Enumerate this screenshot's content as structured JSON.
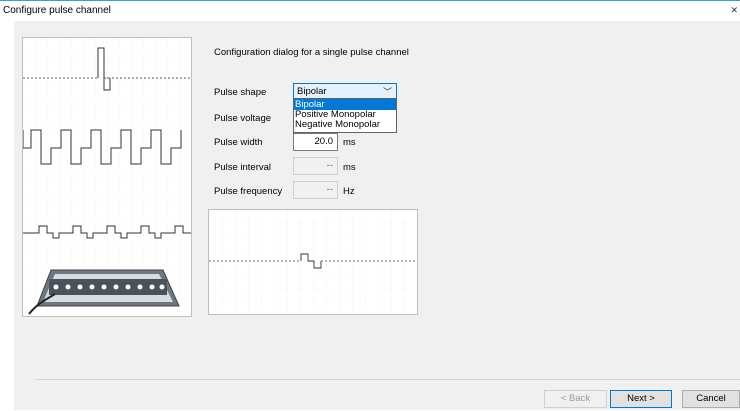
{
  "window": {
    "title": "Configure pulse channel"
  },
  "description": "Configuration dialog for a single pulse channel",
  "fields": {
    "shape": {
      "label": "Pulse shape",
      "value": "Bipolar",
      "options": [
        "Bipolar",
        "Positive Monopolar",
        "Negative Monopolar"
      ]
    },
    "voltage": {
      "label": "Pulse voltage"
    },
    "width": {
      "label": "Pulse width",
      "value": "20.0",
      "unit": "ms"
    },
    "interval": {
      "label": "Pulse interval",
      "value": "--",
      "unit": "ms"
    },
    "frequency": {
      "label": "Pulse frequency",
      "value": "--",
      "unit": "Hz"
    }
  },
  "buttons": {
    "back": "< Back",
    "next": "Next >",
    "cancel": "Cancel"
  },
  "colors": {
    "accent": "#0078d7",
    "window_border": "#3c9be0"
  }
}
